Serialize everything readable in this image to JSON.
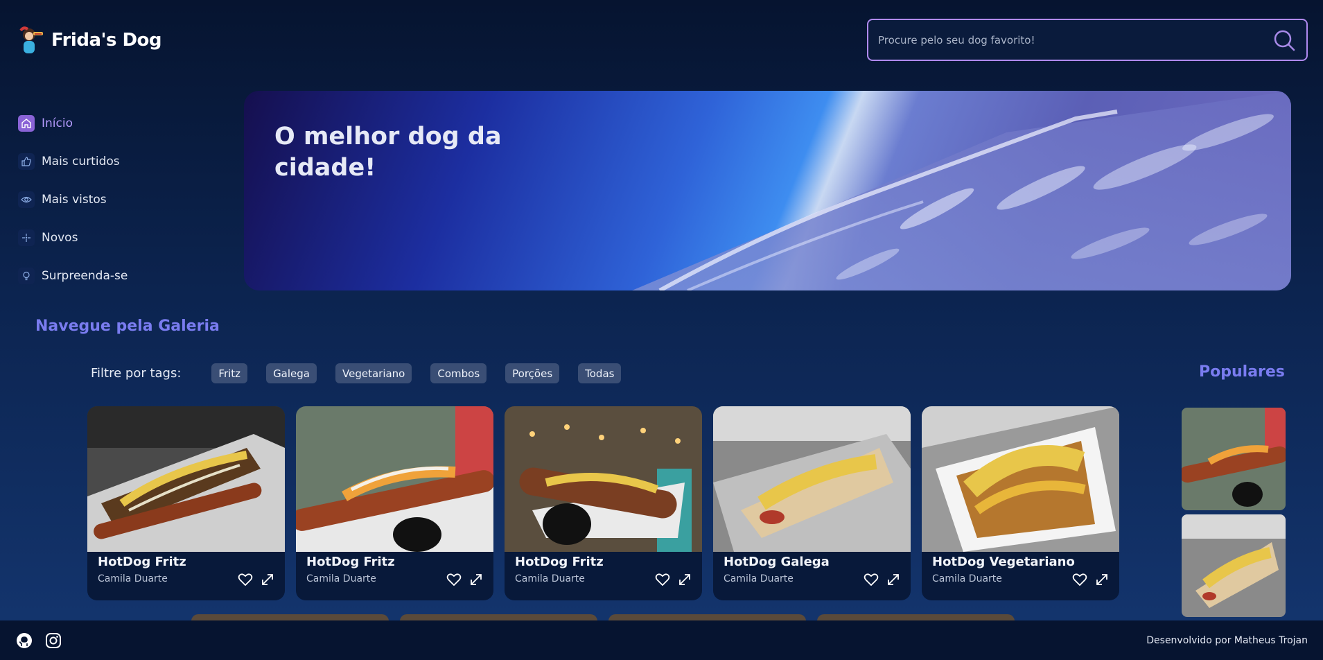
{
  "app": {
    "name": "Frida's Dog"
  },
  "search": {
    "placeholder": "Procure pelo seu dog favorito!"
  },
  "sidebar": {
    "items": [
      {
        "label": "Início",
        "icon": "home-icon",
        "active": true
      },
      {
        "label": "Mais curtidos",
        "icon": "thumbs-up-icon"
      },
      {
        "label": "Mais vistos",
        "icon": "eye-icon"
      },
      {
        "label": "Novos",
        "icon": "sparkle-icon"
      },
      {
        "label": "Surpreenda-se",
        "icon": "lightbulb-icon"
      }
    ]
  },
  "banner": {
    "title": "O melhor dog da cidade!"
  },
  "gallery": {
    "title": "Navegue pela Galeria",
    "filter_label": "Filtre por tags:",
    "tags": [
      "Fritz",
      "Galega",
      "Vegetariano",
      "Combos",
      "Porções",
      "Todas"
    ],
    "cards": [
      {
        "name": "HotDog Fritz",
        "author": "Camila Duarte"
      },
      {
        "name": "HotDog Fritz",
        "author": "Camila Duarte"
      },
      {
        "name": "HotDog Fritz",
        "author": "Camila Duarte"
      },
      {
        "name": "HotDog Galega",
        "author": "Camila Duarte"
      },
      {
        "name": "HotDog Vegetariano",
        "author": "Camila Duarte"
      }
    ]
  },
  "popular": {
    "title": "Populares"
  },
  "footer": {
    "credit": "Desenvolvido por Matheus Trojan"
  },
  "colors": {
    "accent": "#7a7cf0",
    "active": "#b69cff",
    "search_border": "#b08af0",
    "background": "#0c2450"
  }
}
